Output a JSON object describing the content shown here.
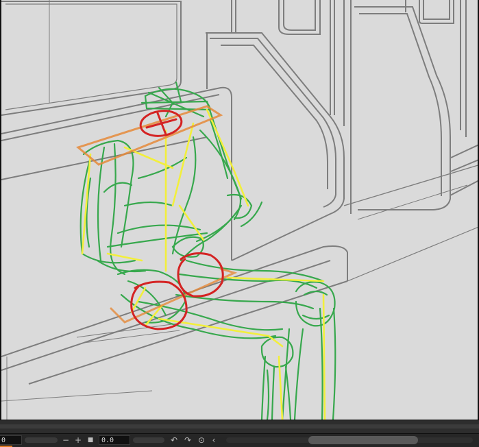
{
  "canvas": {
    "description_label": "",
    "colors": {
      "background": "#dadada",
      "lineart": "#7d7d7d",
      "green_sketch": "#37a84d",
      "yellow_guides": "#f2ef3c",
      "orange_planes": "#e58a3a",
      "red_marks": "#d42323"
    }
  },
  "timeline": {
    "frame_value": "0",
    "opacity_value": "0.0",
    "zoom_out_icon": "minus-icon",
    "zoom_in_icon": "plus-icon",
    "stop_icon": "square-stop-icon",
    "undo_icon": "undo-icon",
    "redo_icon": "redo-icon",
    "record_icon": "record-icon",
    "prev_icon": "chevron-left-icon"
  }
}
